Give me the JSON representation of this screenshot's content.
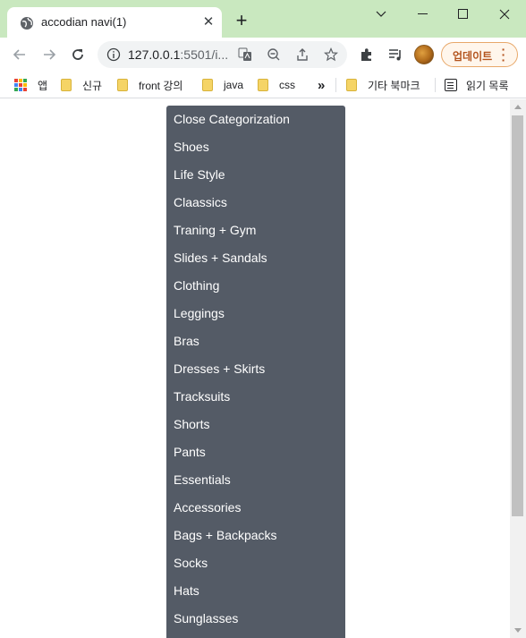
{
  "tab": {
    "title": "accodian navi(1)",
    "close_glyph": "✕",
    "new_tab_glyph": "+"
  },
  "window_controls": [
    "chevron-down-icon",
    "minimize-icon",
    "maximize-icon",
    "close-icon"
  ],
  "address_bar": {
    "url_host": "127.0.0.1",
    "url_rest": ":5501/i..."
  },
  "update_button": {
    "label": "업데이트",
    "menu_glyph": "⋮"
  },
  "bookmarks": {
    "apps": "앱",
    "items": [
      "신규",
      "front 강의",
      "java",
      "css"
    ],
    "overflow": "»",
    "other": "기타 북마크",
    "reading_list": "읽기 목록"
  },
  "nav_menu": {
    "items": [
      "Close Categorization",
      "Shoes",
      "Life Style",
      "Claassics",
      "Traning + Gym",
      "Slides + Sandals",
      "Clothing",
      "Leggings",
      "Bras",
      "Dresses + Skirts",
      "Tracksuits",
      "Shorts",
      "Pants",
      "Essentials",
      "Accessories",
      "Bags + Backpacks",
      "Socks",
      "Hats",
      "Sunglasses"
    ]
  },
  "colors": {
    "tabstrip": "#c9e8bf",
    "menu_background": "#545b66",
    "menu_text": "#ffffff",
    "update_accent": "#b3541e"
  }
}
